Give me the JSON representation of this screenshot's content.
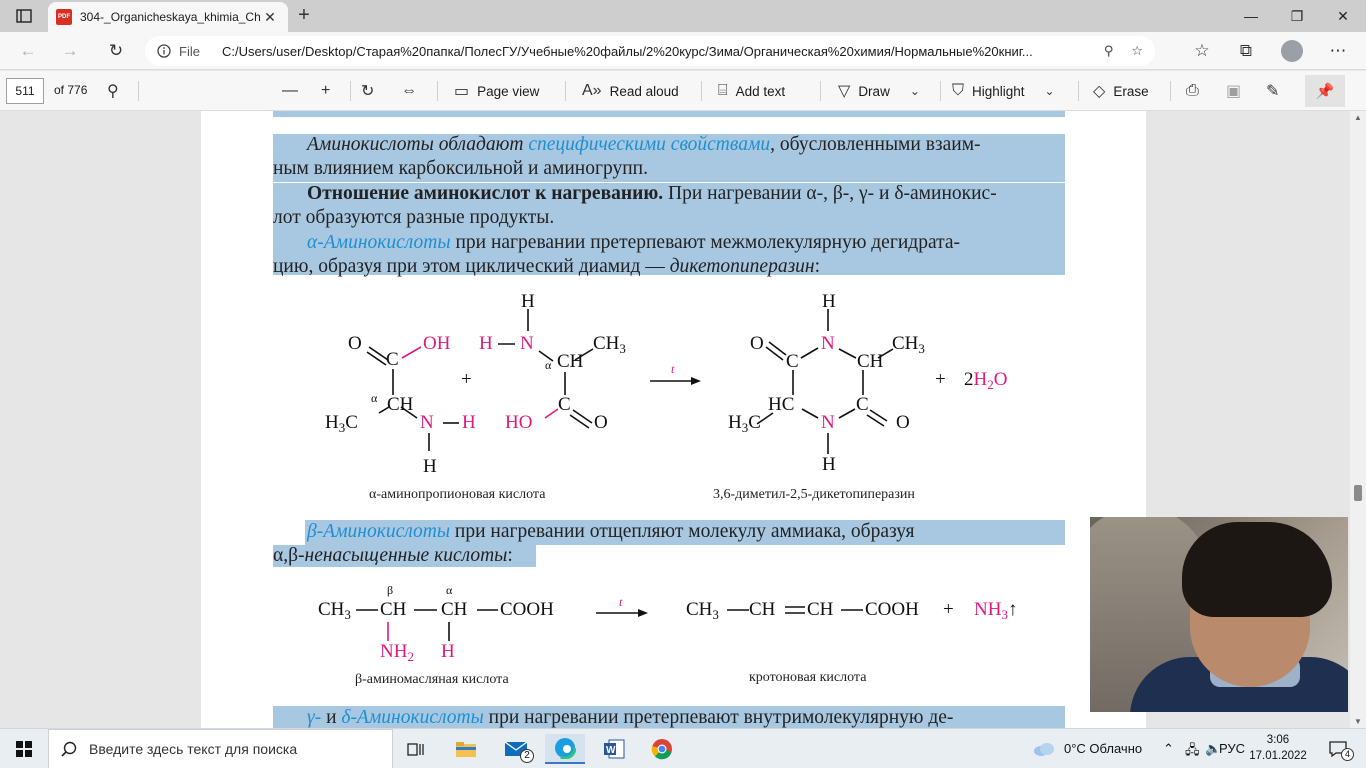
{
  "tab": {
    "title": "304-_Organicheskaya_khimia_Ch",
    "pdf_badge": "PDF",
    "close": "✕",
    "new_tab": "+"
  },
  "window_controls": {
    "minimize": "—",
    "restore": "❐",
    "close": "✕"
  },
  "address_bar": {
    "file_label": "File",
    "url": "C:/Users/user/Desktop/Старая%20папка/ПолесГУ/Учебные%20файлы/2%20курс/Зима/Органическая%20химия/Нормальные%20книг..."
  },
  "pdf_toolbar": {
    "page_number": "511",
    "page_of": "of 776",
    "page_view": "Page view",
    "read_aloud": "Read aloud",
    "add_text": "Add text",
    "draw": "Draw",
    "highlight": "Highlight",
    "erase": "Erase"
  },
  "document": {
    "p1": {
      "lead_italic": "Аминокислоты обладают ",
      "link": "специфическими свойствами",
      "rest": ", обусловленными взаим-",
      "line2": "ным влиянием карбоксильной и аминогрупп."
    },
    "p2": {
      "bold": "Отношение аминокислот к нагреванию.",
      "rest": " При нагревании α-, β-, γ- и δ-аминокис-",
      "line2": "лот образуются разные продукты."
    },
    "p3": {
      "cyan": "α-Аминокислоты",
      "rest": " при нагревании претерпевают межмолекулярную дегидрата-",
      "line2_pre": "цию, образуя при этом циклический диамид — ",
      "line2_italic": "дикетопиперазин",
      "line2_end": ":"
    },
    "reaction1": {
      "caption_left": "α-аминопропионовая кислота",
      "caption_right": "3,6-диметил-2,5-дикетопиперазин",
      "arrow_label": "t",
      "plus": "+",
      "alpha": "α",
      "water_coef": "2H",
      "water_sub": "2",
      "water_o": "O"
    },
    "p4": {
      "cyan": "β-Аминокислоты",
      "rest": " при нагревании отщепляют молекулу аммиака, образуя",
      "line2_pre": "α,β-",
      "line2_italic": "ненасыщенные кислоты",
      "line2_end": ":"
    },
    "reaction2": {
      "caption_left": "β-аминомасляная кислота",
      "caption_right": "кротоновая кислота",
      "arrow_label": "t",
      "beta": "β",
      "alpha": "α",
      "left_formula_cooh": "COOH",
      "right_cooh": "COOH",
      "nh3_mark": "↑",
      "plus": "+"
    },
    "p5": {
      "cyan1": "γ-",
      "mid": " и ",
      "cyan2": "δ-Аминокислоты",
      "rest": " при нагревании претерпевают внутримолекулярную де-"
    }
  },
  "taskbar": {
    "search_placeholder": "Введите здесь текст для поиска",
    "mail_badge": "2",
    "weather": "0°C  Облачно",
    "lang": "РУС",
    "time": "3:06",
    "date": "17.01.2022",
    "notif_count": "4"
  }
}
